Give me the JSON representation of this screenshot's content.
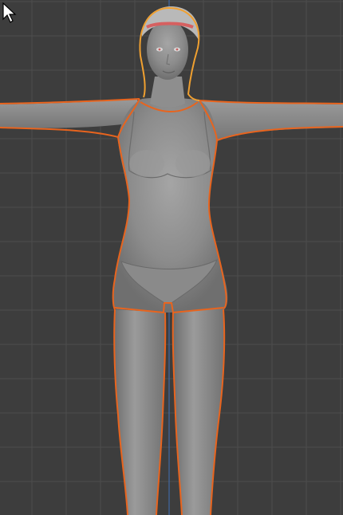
{
  "viewport": {
    "background": "#3d3d3d",
    "grid_color": "#4d4d4d",
    "center_axis_color": "#3f6fb8"
  },
  "model": {
    "skin_color": "#8a8a8a",
    "selection_outline_color": "#e8641e",
    "active_outline_color": "#f0a030",
    "hair_band_color": "#d66060"
  },
  "cursor": {
    "icon": "arrow-pointer-icon",
    "color": "#ffffff"
  }
}
